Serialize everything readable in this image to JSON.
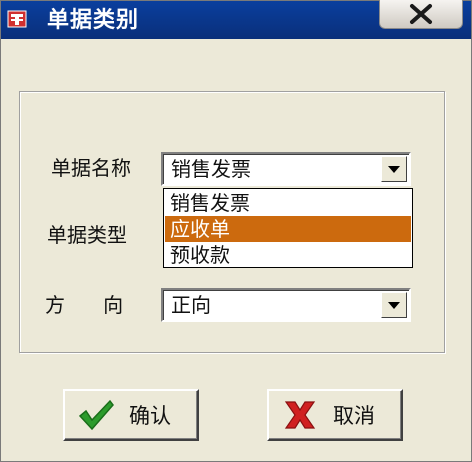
{
  "window": {
    "title": "单据类别"
  },
  "form": {
    "doc_name_label": "单据名称",
    "doc_type_label": "单据类型",
    "direction_label": "方      向",
    "doc_name_value": "销售发票",
    "direction_value": "正向",
    "dropdown_options": [
      "销售发票",
      "应收单",
      "预收款"
    ],
    "selected_option": "应收单"
  },
  "buttons": {
    "ok_label": "确认",
    "cancel_label": "取消"
  },
  "colors": {
    "title_bar": "#0a3f9e",
    "selection": "#cc6a0e",
    "ok_icon": "#2c9b2c",
    "cancel_icon": "#d02020"
  },
  "icons": {
    "app": "app-icon",
    "close": "close-icon",
    "dropdown": "chevron-down-icon",
    "ok": "checkmark-icon",
    "cancel": "x-icon"
  }
}
